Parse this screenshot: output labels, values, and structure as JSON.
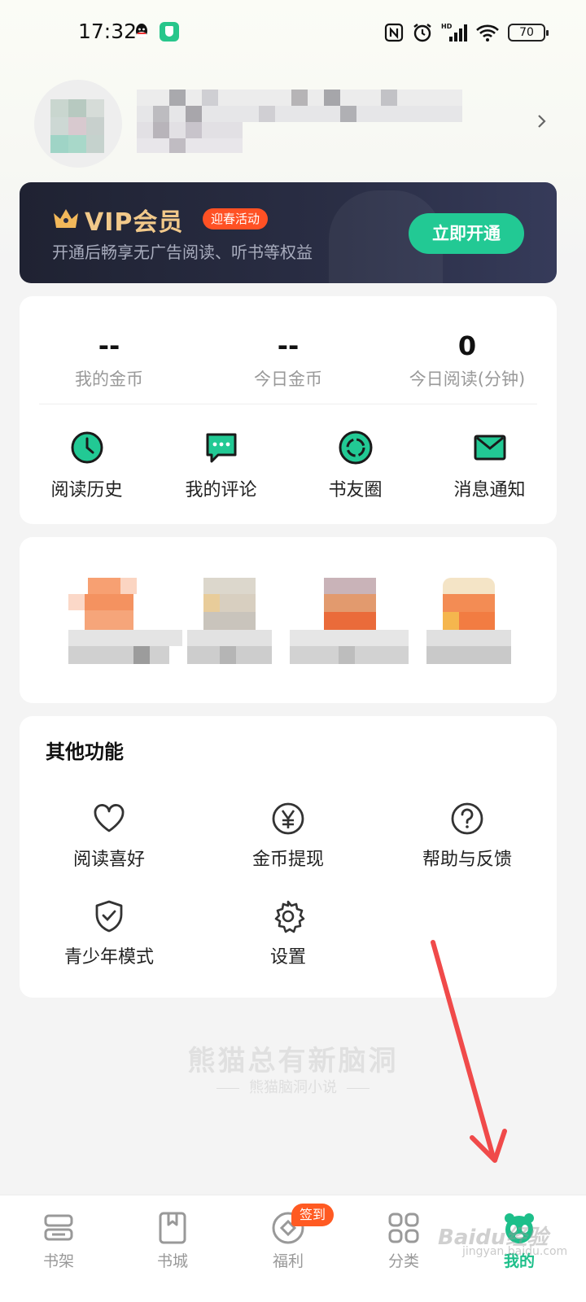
{
  "status_bar": {
    "time": "17:32",
    "battery": "70",
    "icons": [
      "qq-icon",
      "shield-app-icon",
      "nfc-icon",
      "alarm-icon",
      "hd-signal-icon",
      "wifi-icon",
      "battery-icon"
    ]
  },
  "profile": {
    "username": "",
    "chevron_icon": "chevron-right-icon"
  },
  "vip": {
    "title": "VIP会员",
    "badge": "迎春活动",
    "subtitle": "开通后畅享无广告阅读、听书等权益",
    "button": "立即开通",
    "colors": {
      "accent": "#22c994",
      "gold": "#f2c98a",
      "badge": "#ff5124",
      "card": "#252839"
    }
  },
  "stats": [
    {
      "value": "--",
      "label": "我的金币"
    },
    {
      "value": "--",
      "label": "今日金币"
    },
    {
      "value": "0",
      "label": "今日阅读(分钟)"
    }
  ],
  "quick_actions": [
    {
      "label": "阅读历史",
      "icon": "clock-icon"
    },
    {
      "label": "我的评论",
      "icon": "comment-icon"
    },
    {
      "label": "书友圈",
      "icon": "circle-icon"
    },
    {
      "label": "消息通知",
      "icon": "mail-icon"
    }
  ],
  "other_functions": {
    "title": "其他功能",
    "items": [
      {
        "label": "阅读喜好",
        "icon": "heart-icon"
      },
      {
        "label": "金币提现",
        "icon": "yen-coin-icon"
      },
      {
        "label": "帮助与反馈",
        "icon": "help-icon"
      },
      {
        "label": "青少年模式",
        "icon": "shield-check-icon"
      },
      {
        "label": "设置",
        "icon": "gear-icon"
      }
    ]
  },
  "watermark": {
    "main": "熊猫总有新脑洞",
    "sub": "熊猫脑洞小说"
  },
  "bottom_nav": {
    "tabs": [
      {
        "label": "书架",
        "icon": "bookshelf-icon"
      },
      {
        "label": "书城",
        "icon": "book-icon"
      },
      {
        "label": "福利",
        "icon": "gift-coin-icon",
        "badge": "签到"
      },
      {
        "label": "分类",
        "icon": "grid-icon"
      },
      {
        "label": "我的",
        "icon": "panda-icon",
        "active": true
      }
    ],
    "active_color": "#1dbf8a"
  },
  "overlay": {
    "baidu_watermark": "Baidu经验",
    "baidu_watermark_sub": "jingyan.baidu.com"
  }
}
